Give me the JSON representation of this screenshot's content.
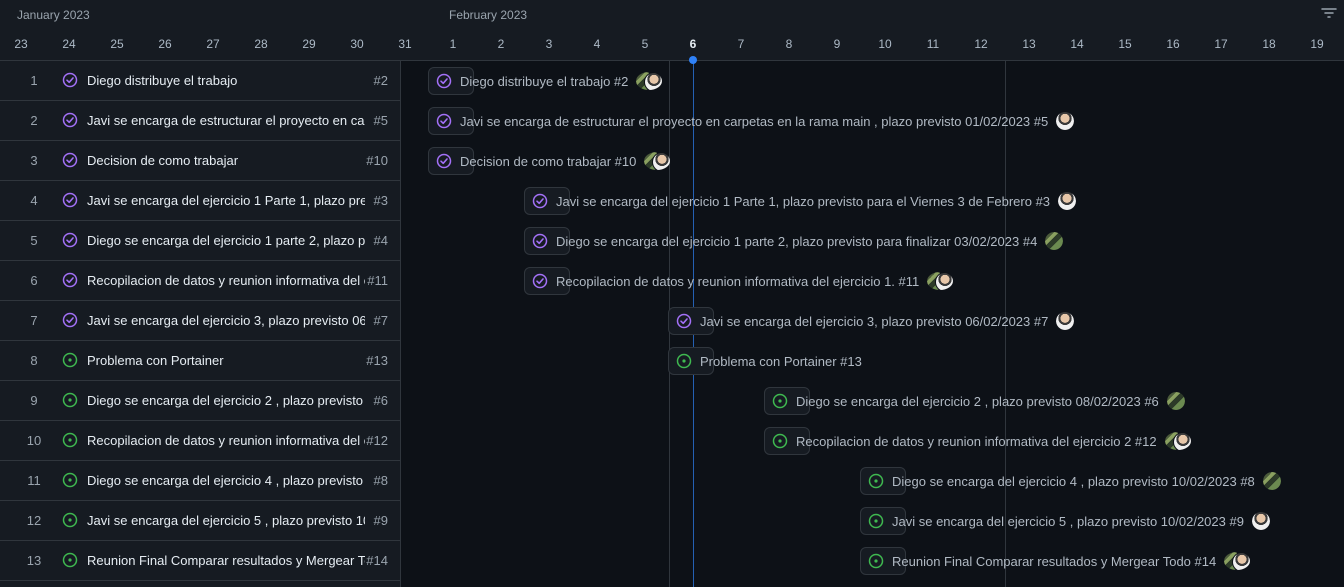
{
  "header": {
    "months": [
      {
        "label": "January 2023",
        "col": 0
      },
      {
        "label": "February 2023",
        "col": 9
      }
    ],
    "days": [
      "23",
      "24",
      "25",
      "26",
      "27",
      "28",
      "29",
      "30",
      "31",
      "1",
      "2",
      "3",
      "4",
      "5",
      "6",
      "7",
      "8",
      "9",
      "10",
      "11",
      "12",
      "13",
      "14",
      "15",
      "16",
      "17",
      "18",
      "19"
    ],
    "today_index": 14
  },
  "icons": {
    "filter": "filter-icon",
    "closed": "check-circle-icon",
    "open": "issue-open-icon"
  },
  "colors": {
    "closed": "#a371f7",
    "open": "#3fb950",
    "today": "#2f81f7"
  },
  "rows": [
    {
      "n": "1",
      "title": "Diego distribuye el trabajo",
      "num": "#2",
      "label": "Diego distribuye el trabajo #2",
      "status": "closed",
      "start": 9,
      "avatar": "pair"
    },
    {
      "n": "2",
      "title": "Javi se encarga de estructurar el proyecto en carpetas en la rama main , plazo previsto 01/02/2023",
      "num": "#5",
      "label": "Javi se encarga de estructurar el proyecto en carpetas en la rama main , plazo previsto 01/02/2023 #5",
      "status": "closed",
      "start": 9,
      "avatar": "javi"
    },
    {
      "n": "3",
      "title": "Decision de como trabajar",
      "num": "#10",
      "label": "Decision de como trabajar #10",
      "status": "closed",
      "start": 9,
      "avatar": "pair"
    },
    {
      "n": "4",
      "title": "Javi se encarga del ejercicio 1 Parte 1, plazo previsto para el Viernes 3 de Febrero",
      "num": "#3",
      "label": "Javi se encarga del ejercicio 1 Parte 1, plazo previsto para el Viernes 3 de Febrero #3",
      "status": "closed",
      "start": 11,
      "avatar": "javi"
    },
    {
      "n": "5",
      "title": "Diego se encarga del ejercicio 1 parte 2, plazo previsto para finalizar 03/02/2023",
      "num": "#4",
      "label": "Diego se encarga del ejercicio 1 parte 2, plazo previsto para finalizar 03/02/2023 #4",
      "status": "closed",
      "start": 11,
      "avatar": "diego"
    },
    {
      "n": "6",
      "title": "Recopilacion de datos y reunion informativa del ejercicio 1.",
      "num": "#11",
      "label": "Recopilacion de datos y reunion informativa del ejercicio 1. #11",
      "status": "closed",
      "start": 11,
      "avatar": "pair"
    },
    {
      "n": "7",
      "title": "Javi se encarga del ejercicio 3, plazo previsto 06/02/2023",
      "num": "#7",
      "label": "Javi se encarga del ejercicio 3, plazo previsto 06/02/2023 #7",
      "status": "closed",
      "start": 14,
      "avatar": "javi"
    },
    {
      "n": "8",
      "title": "Problema con Portainer",
      "num": "#13",
      "label": "Problema con Portainer #13",
      "status": "open",
      "start": 14,
      "avatar": "none"
    },
    {
      "n": "9",
      "title": "Diego se encarga del ejercicio 2 , plazo previsto 08/02/2023",
      "num": "#6",
      "label": "Diego se encarga del ejercicio 2 , plazo previsto 08/02/2023 #6",
      "status": "open",
      "start": 16,
      "avatar": "diego"
    },
    {
      "n": "10",
      "title": "Recopilacion de datos y reunion informativa del ejercicio 2",
      "num": "#12",
      "label": "Recopilacion de datos y reunion informativa del ejercicio 2 #12",
      "status": "open",
      "start": 16,
      "avatar": "pair"
    },
    {
      "n": "11",
      "title": "Diego se encarga del ejercicio 4 , plazo previsto 10/02/2023",
      "num": "#8",
      "label": "Diego se encarga del ejercicio 4 , plazo previsto 10/02/2023 #8",
      "status": "open",
      "start": 18,
      "avatar": "diego"
    },
    {
      "n": "12",
      "title": "Javi se encarga del ejercicio 5 , plazo previsto 10/02/2023",
      "num": "#9",
      "label": "Javi se encarga del ejercicio 5 , plazo previsto 10/02/2023 #9",
      "status": "open",
      "start": 18,
      "avatar": "javi"
    },
    {
      "n": "13",
      "title": "Reunion Final Comparar resultados y Mergear Todo",
      "num": "#14",
      "label": "Reunion Final Comparar resultados y Mergear Todo #14",
      "status": "open",
      "start": 18,
      "avatar": "pair"
    }
  ]
}
